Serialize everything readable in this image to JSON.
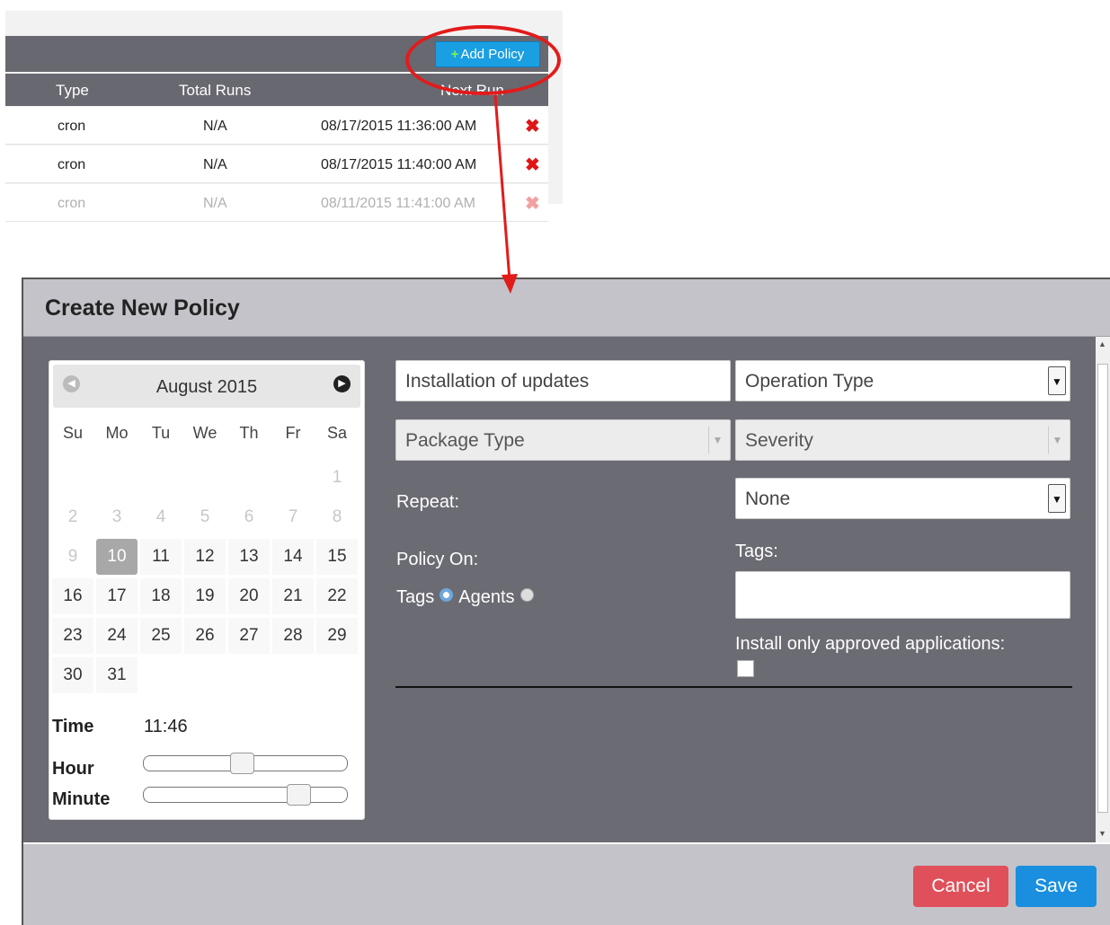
{
  "top_table": {
    "add_policy_label": "Add Policy",
    "columns": [
      "Type",
      "Total Runs",
      "Next Run"
    ],
    "rows": [
      {
        "type": "cron",
        "total_runs": "N/A",
        "next_run": "08/17/2015 11:36:00 AM"
      },
      {
        "type": "cron",
        "total_runs": "N/A",
        "next_run": "08/17/2015 11:40:00 AM"
      },
      {
        "type": "cron",
        "total_runs": "N/A",
        "next_run": "08/11/2015 11:41:00 AM"
      }
    ],
    "delete_icon": "✖"
  },
  "modal": {
    "title": "Create New Policy",
    "calendar": {
      "month_label": "August 2015",
      "weekdays": [
        "Su",
        "Mo",
        "Tu",
        "We",
        "Th",
        "Fr",
        "Sa"
      ],
      "selected_day": "10",
      "time_label": "Time",
      "time_value": "11:46",
      "hour_label": "Hour",
      "minute_label": "Minute",
      "hour_fraction": 0.48,
      "minute_fraction": 0.79
    },
    "form": {
      "policy_name": "Installation of updates",
      "operation_type": "Operation Type",
      "package_type": "Package Type",
      "severity": "Severity",
      "repeat_label": "Repeat:",
      "repeat_value": "None",
      "policy_on_label": "Policy On:",
      "tags_option": "Tags",
      "agents_option": "Agents",
      "tags_label": "Tags:",
      "tags_value": "",
      "approved_label": "Install only approved applications:"
    },
    "footer": {
      "cancel_label": "Cancel",
      "save_label": "Save"
    }
  },
  "colors": {
    "accent": "#1a8fe0",
    "danger": "#e0505a",
    "annotation": "#e21b1b"
  }
}
